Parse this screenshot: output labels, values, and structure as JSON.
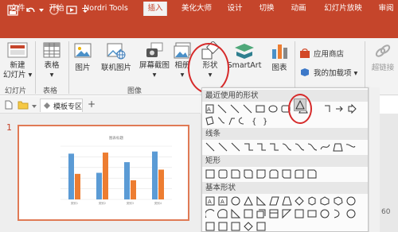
{
  "titlebar": {
    "color": "#c5452b"
  },
  "tabs": [
    {
      "label": "文件"
    },
    {
      "label": "开始"
    },
    {
      "label": "Nordri Tools"
    },
    {
      "label": "插入",
      "active": true
    },
    {
      "label": "美化大师"
    },
    {
      "label": "设计"
    },
    {
      "label": "切换"
    },
    {
      "label": "动画"
    },
    {
      "label": "幻灯片放映"
    },
    {
      "label": "审阅"
    }
  ],
  "ribbon": {
    "new_slide": "新建\n幻灯片 ▾",
    "table": "表格\n▾",
    "picture": "图片",
    "online_picture": "联机图片",
    "screenshot": "屏幕截图\n▾",
    "album": "相册\n▾",
    "shapes": "形状\n▾",
    "smartart": "SmartArt",
    "chart": "图表",
    "app_store": "应用商店",
    "my_addins": "我的加载项 ▾",
    "hyperlink": "超链接",
    "groups": {
      "slides": "幻灯片",
      "tables": "表格",
      "images": "图像"
    }
  },
  "thumbbar": {
    "tab_label": "模板专区",
    "add": "+"
  },
  "slide": {
    "number": "1",
    "chart_title": "图表标题"
  },
  "shapes_menu": {
    "sections": {
      "recent": "最近使用的形状",
      "lines": "线条",
      "rectangles": "矩形",
      "basic": "基本形状"
    }
  },
  "workspace": {
    "zoom_hint": "60"
  },
  "chart_data": {
    "type": "bar",
    "title": "图表标题",
    "categories": [
      "类别1",
      "类别2",
      "类别3",
      "类别4"
    ],
    "series": [
      {
        "name": "系列1",
        "values": [
          4.3,
          2.5,
          3.5,
          4.5
        ],
        "color": "#5b9bd5"
      },
      {
        "name": "系列2",
        "values": [
          2.4,
          4.4,
          1.8,
          2.8
        ],
        "color": "#ed7d31"
      }
    ],
    "ylim": [
      0,
      5
    ],
    "grid": true
  }
}
